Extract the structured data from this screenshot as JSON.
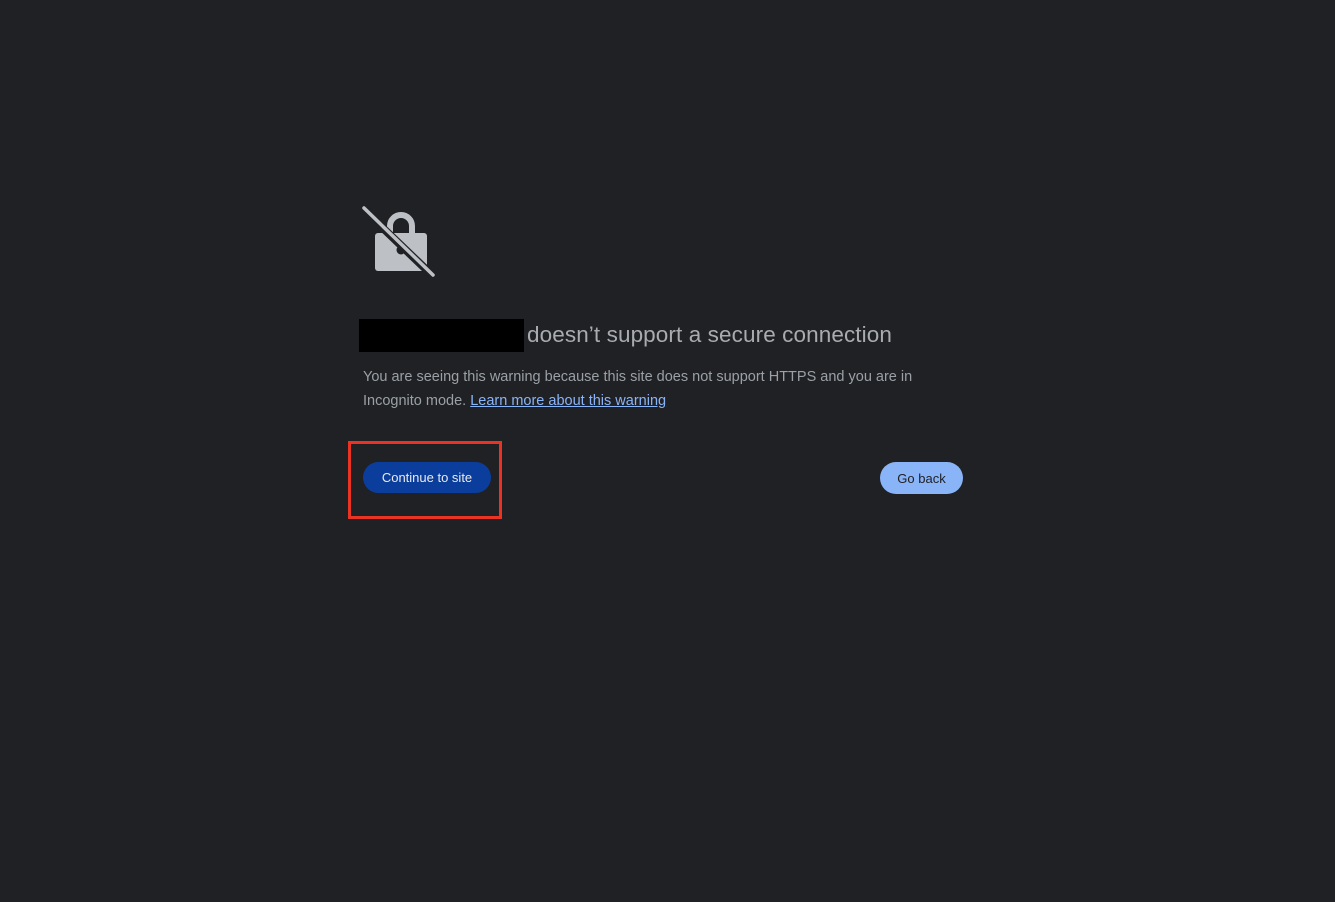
{
  "page": {
    "headline": "doesn’t support a secure connection",
    "explanation_text": "You are seeing this warning because this site does not support HTTPS and you are in Incognito mode. ",
    "learn_more_link": "Learn more about this warning",
    "continue_button": "Continue to site",
    "go_back_button": "Go back"
  },
  "icons": {
    "main_icon": "lock-crossed-icon"
  },
  "colors": {
    "background": "#202124",
    "primary_button": "#0b3e9c",
    "secondary_button": "#8ab4f8",
    "link": "#8ab4f8",
    "annotation": "#ea3323"
  }
}
